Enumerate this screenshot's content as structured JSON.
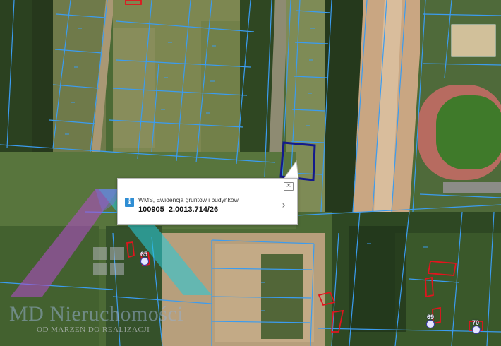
{
  "colors": {
    "parcel_line": "#3b9cf0",
    "selected_parcel": "#141a8c",
    "building_outline": "#e2141e",
    "info_icon": "#2f8ed4"
  },
  "popup": {
    "source": "WMS, Ewidencja gruntów i budynków",
    "parcel_id": "100905_2.0013.714/26",
    "close_icon": "×",
    "chevron_icon": "›"
  },
  "address_numbers": [
    "65",
    "69",
    "70"
  ],
  "watermark": {
    "name": "MD Nieruchomości",
    "tagline": "OD MARZEŃ DO REALIZACJI"
  }
}
